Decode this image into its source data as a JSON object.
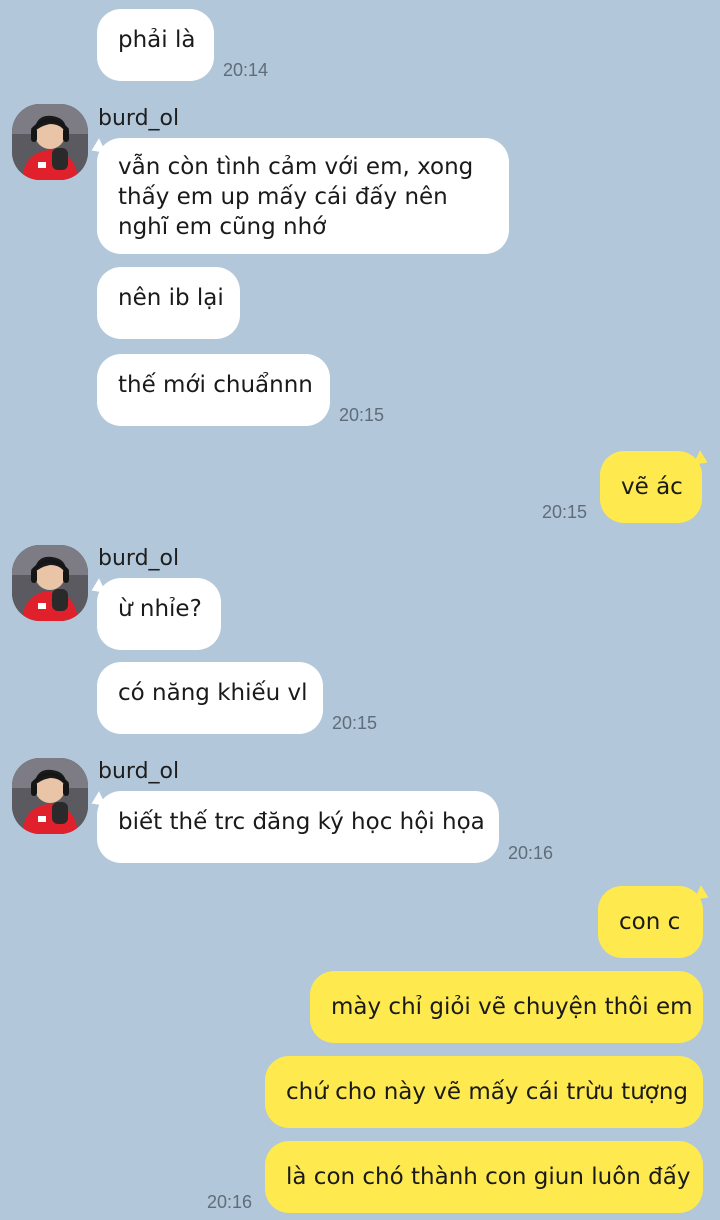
{
  "colors": {
    "background": "#b2c7d9",
    "incoming_bubble": "#ffffff",
    "outgoing_bubble": "#fee94e",
    "timestamp": "#5f6d7a"
  },
  "messages": {
    "m1": {
      "text": "phải là",
      "time": "20:14"
    },
    "g1": {
      "sender": "burd_ol",
      "m2": "vẫn còn tình cảm với em, xong thấy em up mấy cái đấy nên nghĩ em cũng nhớ",
      "m3": "nên ib lại",
      "m4": "thế mới chuẩnnn",
      "time": "20:15"
    },
    "o1": {
      "text": "vẽ ác",
      "time": "20:15"
    },
    "g2": {
      "sender": "burd_ol",
      "m1": "ừ nhỉe?",
      "m2": "có năng khiếu vl",
      "time": "20:15"
    },
    "g3": {
      "sender": "burd_ol",
      "m1": "biết thế trc đăng ký học hội họa",
      "time": "20:16"
    },
    "o2": {
      "m1": "con c",
      "m2": "mày chỉ giỏi vẽ chuyện thôi em",
      "m3": "chứ cho này vẽ mấy cái trừu tượng",
      "m4": "là con chó thành con giun luôn đấy",
      "time": "20:16"
    }
  },
  "icons": {
    "avatar": "profile-photo-avatar"
  }
}
